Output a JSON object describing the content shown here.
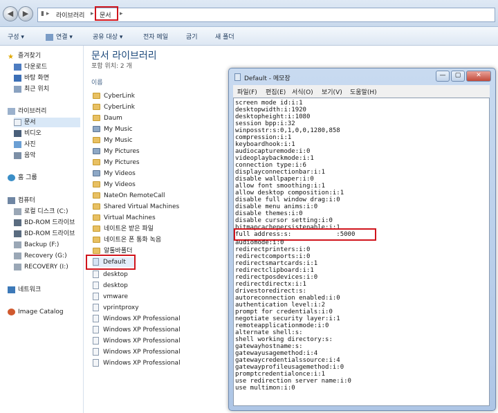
{
  "addressbar": {
    "crumbs": [
      "라이브러리",
      "문서"
    ]
  },
  "toolbar": {
    "items": [
      "구성 ▾",
      "연결 ▾",
      "공유 대상 ▾",
      "전자 메일",
      "굽기",
      "새 폴더"
    ]
  },
  "nav": {
    "favorites": "즐겨찾기",
    "favorite_items": [
      "다운로드",
      "바탕 화면",
      "최근 위치"
    ],
    "libraries": "라이브러리",
    "library_items": [
      "문서",
      "비디오",
      "사진",
      "음악"
    ],
    "homegroup": "홈 그룹",
    "computer": "컴퓨터",
    "computer_items": [
      "로컬 디스크 (C:)",
      "BD-ROM 드라이브",
      "BD-ROM 드라이브",
      "Backup (F:)",
      "Recovery (G:)",
      "RECOVERY (I:)"
    ],
    "network": "네트워크",
    "image_catalog": "Image Catalog"
  },
  "library": {
    "title": "문서 라이브러리",
    "subtitle": "포함 위치:  2 개",
    "column_header": "이름",
    "files": [
      "CyberLink",
      "CyberLink",
      "Daum",
      "My Music",
      "My Music",
      "My Pictures",
      "My Pictures",
      "My Videos",
      "My Videos",
      "NateOn RemoteCall",
      "Shared Virtual Machines",
      "Virtual Machines",
      "네이트온 받은 파일",
      "네이트온 폰 통화 녹음",
      "알툴바폴더",
      "Default",
      "desktop",
      "desktop",
      "vmware",
      "vprintproxy",
      "Windows XP Professional",
      "Windows XP Professional",
      "Windows XP Professional",
      "Windows XP Professional",
      "Windows XP Professional"
    ]
  },
  "notepad": {
    "title": "Default - 메모장",
    "menu": [
      "파일(F)",
      "편집(E)",
      "서식(O)",
      "보기(V)",
      "도움말(H)"
    ],
    "lines": [
      "screen mode id:i:1",
      "desktopwidth:i:1920",
      "desktopheight:i:1080",
      "session bpp:i:32",
      "winposstr:s:0,1,0,0,1280,858",
      "compression:i:1",
      "keyboardhook:i:1",
      "audiocapturemode:i:0",
      "videoplaybackmode:i:1",
      "connection type:i:6",
      "displayconnectionbar:i:1",
      "disable wallpaper:i:0",
      "allow font smoothing:i:1",
      "allow desktop composition:i:1",
      "disable full window drag:i:0",
      "disable menu anims:i:0",
      "disable themes:i:0",
      "disable cursor setting:i:0",
      "bitmapcachepersistenable:i:1",
      "full address:s:            :5000",
      "audiomode:i:0",
      "redirectprinters:i:0",
      "redirectcomports:i:0",
      "redirectsmartcards:i:1",
      "redirectclipboard:i:1",
      "redirectposdevices:i:0",
      "redirectdirectx:i:1",
      "drivestoredirect:s:",
      "autoreconnection enabled:i:0",
      "authentication level:i:2",
      "prompt for credentials:i:0",
      "negotiate security layer:i:1",
      "remoteapplicationmode:i:0",
      "alternate shell:s:",
      "shell working directory:s:",
      "gatewayhostname:s:",
      "gatewayusagemethod:i:4",
      "gatewaycredentialssource:i:4",
      "gatewayprofileusagemethod:i:0",
      "promptcredentialonce:i:1",
      "use redirection server name:i:0",
      "use multimon:i:0"
    ]
  }
}
